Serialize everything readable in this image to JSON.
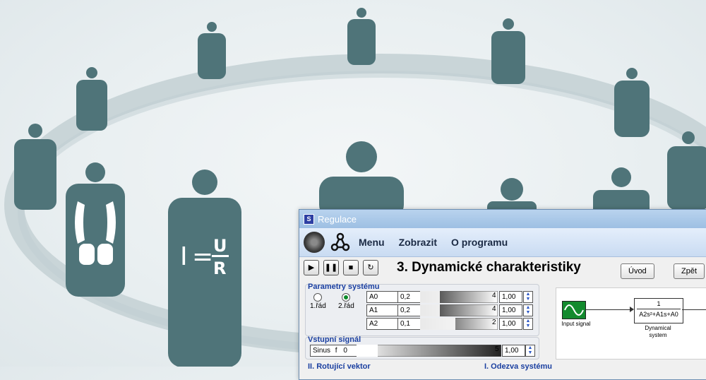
{
  "background": {
    "formula": {
      "lhs": "I",
      "eq": "=",
      "num": "U",
      "den": "R"
    },
    "colors": {
      "figure": "#4f7479",
      "ring": "#c9d5d8"
    }
  },
  "window": {
    "title": "Regulace",
    "app_icon": "S",
    "menu": [
      "Menu",
      "Zobrazit",
      "O programu"
    ],
    "toolbar": {
      "buttons": [
        "play-icon",
        "pause-icon",
        "stop-icon",
        "reset-icon"
      ],
      "heading": "3. Dynamické charakteristiky",
      "right_buttons": [
        "Úvod",
        "Zpět"
      ]
    },
    "params": {
      "title": "Parametry systému",
      "radios": [
        {
          "label": "1.řád",
          "selected": false
        },
        {
          "label": "2.řád",
          "selected": true
        }
      ],
      "rows": [
        {
          "name": "A0",
          "min": "0,2",
          "max": "4",
          "value": "1,00",
          "level": 0.25
        },
        {
          "name": "A1",
          "min": "0,2",
          "max": "4",
          "value": "1,00",
          "level": 0.25
        },
        {
          "name": "A2",
          "min": "0,1",
          "max": "2",
          "value": "1,00",
          "level": 0.45
        }
      ]
    },
    "input": {
      "title": "Vstupní signál",
      "type": "Sinus",
      "param": "f",
      "min": "0",
      "max": "5",
      "value": "1,00"
    },
    "diagram": {
      "input_label": "Input signal",
      "tf_num": "1",
      "tf_den": "A2s²+A1s+A0",
      "system_label_1": "Dynamical",
      "system_label_2": "system"
    },
    "bottom": {
      "left": "II. Rotující vektor",
      "right": "I. Odezva systému"
    }
  }
}
